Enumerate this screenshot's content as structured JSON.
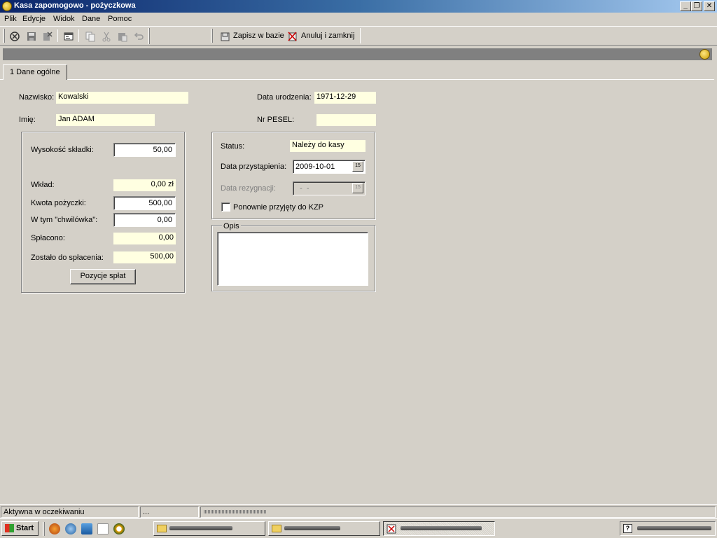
{
  "window": {
    "title": "Kasa zapomogowo - pożyczkowa",
    "controls": {
      "minimize": "_",
      "restore": "❐",
      "close": "✕"
    }
  },
  "menu": [
    "Plik",
    "Edycje",
    "Widok",
    "Dane",
    "Pomoc"
  ],
  "toolbar": {
    "save_label": "Zapisz w bazie",
    "cancel_label": "Anuluj i zamknij"
  },
  "tabs": [
    {
      "label": "1 Dane ogólne",
      "active": true
    }
  ],
  "person": {
    "surname_label": "Nazwisko:",
    "surname": "Kowalski",
    "firstname_label": "Imię:",
    "firstname": "Jan ADAM",
    "birthdate_label": "Data urodzenia:",
    "birthdate": "1971-12-29",
    "pesel_label": "Nr PESEL:",
    "pesel": ""
  },
  "finance": {
    "contribution_label": "Wysokość składki:",
    "contribution": "50,00",
    "deposit_label": "Wkład:",
    "deposit": "0,00 zł",
    "loan_label": "Kwota pożyczki:",
    "loan": "500,00",
    "shortterm_label": "W tym \"chwilówka\":",
    "shortterm": "0,00",
    "repaid_label": "Spłacono:",
    "repaid": "0,00",
    "remaining_label": "Zostało do spłacenia:",
    "remaining": "500,00",
    "payments_button": "Pozycje spłat"
  },
  "membership": {
    "status_label": "Status:",
    "status": "Należy do kasy",
    "join_label": "Data przystąpienia:",
    "join_date": "2009-10-01",
    "resign_label": "Data rezygnacji:",
    "resign_date": "  -  -",
    "readmitted_label": "Ponownie przyjęty do KZP",
    "readmitted": false,
    "calendar_glyph": "15"
  },
  "description": {
    "label": "Opis",
    "value": ""
  },
  "statusbar": {
    "state": "Aktywna w oczekiwaniu",
    "extra": "..."
  },
  "taskbar": {
    "start_label": "Start"
  },
  "colors": {
    "titlebar_start": "#0a246a",
    "titlebar_end": "#a6caf0",
    "face": "#d4d0c8",
    "readonly_field": "#ffffe1",
    "strip": "#808080"
  }
}
